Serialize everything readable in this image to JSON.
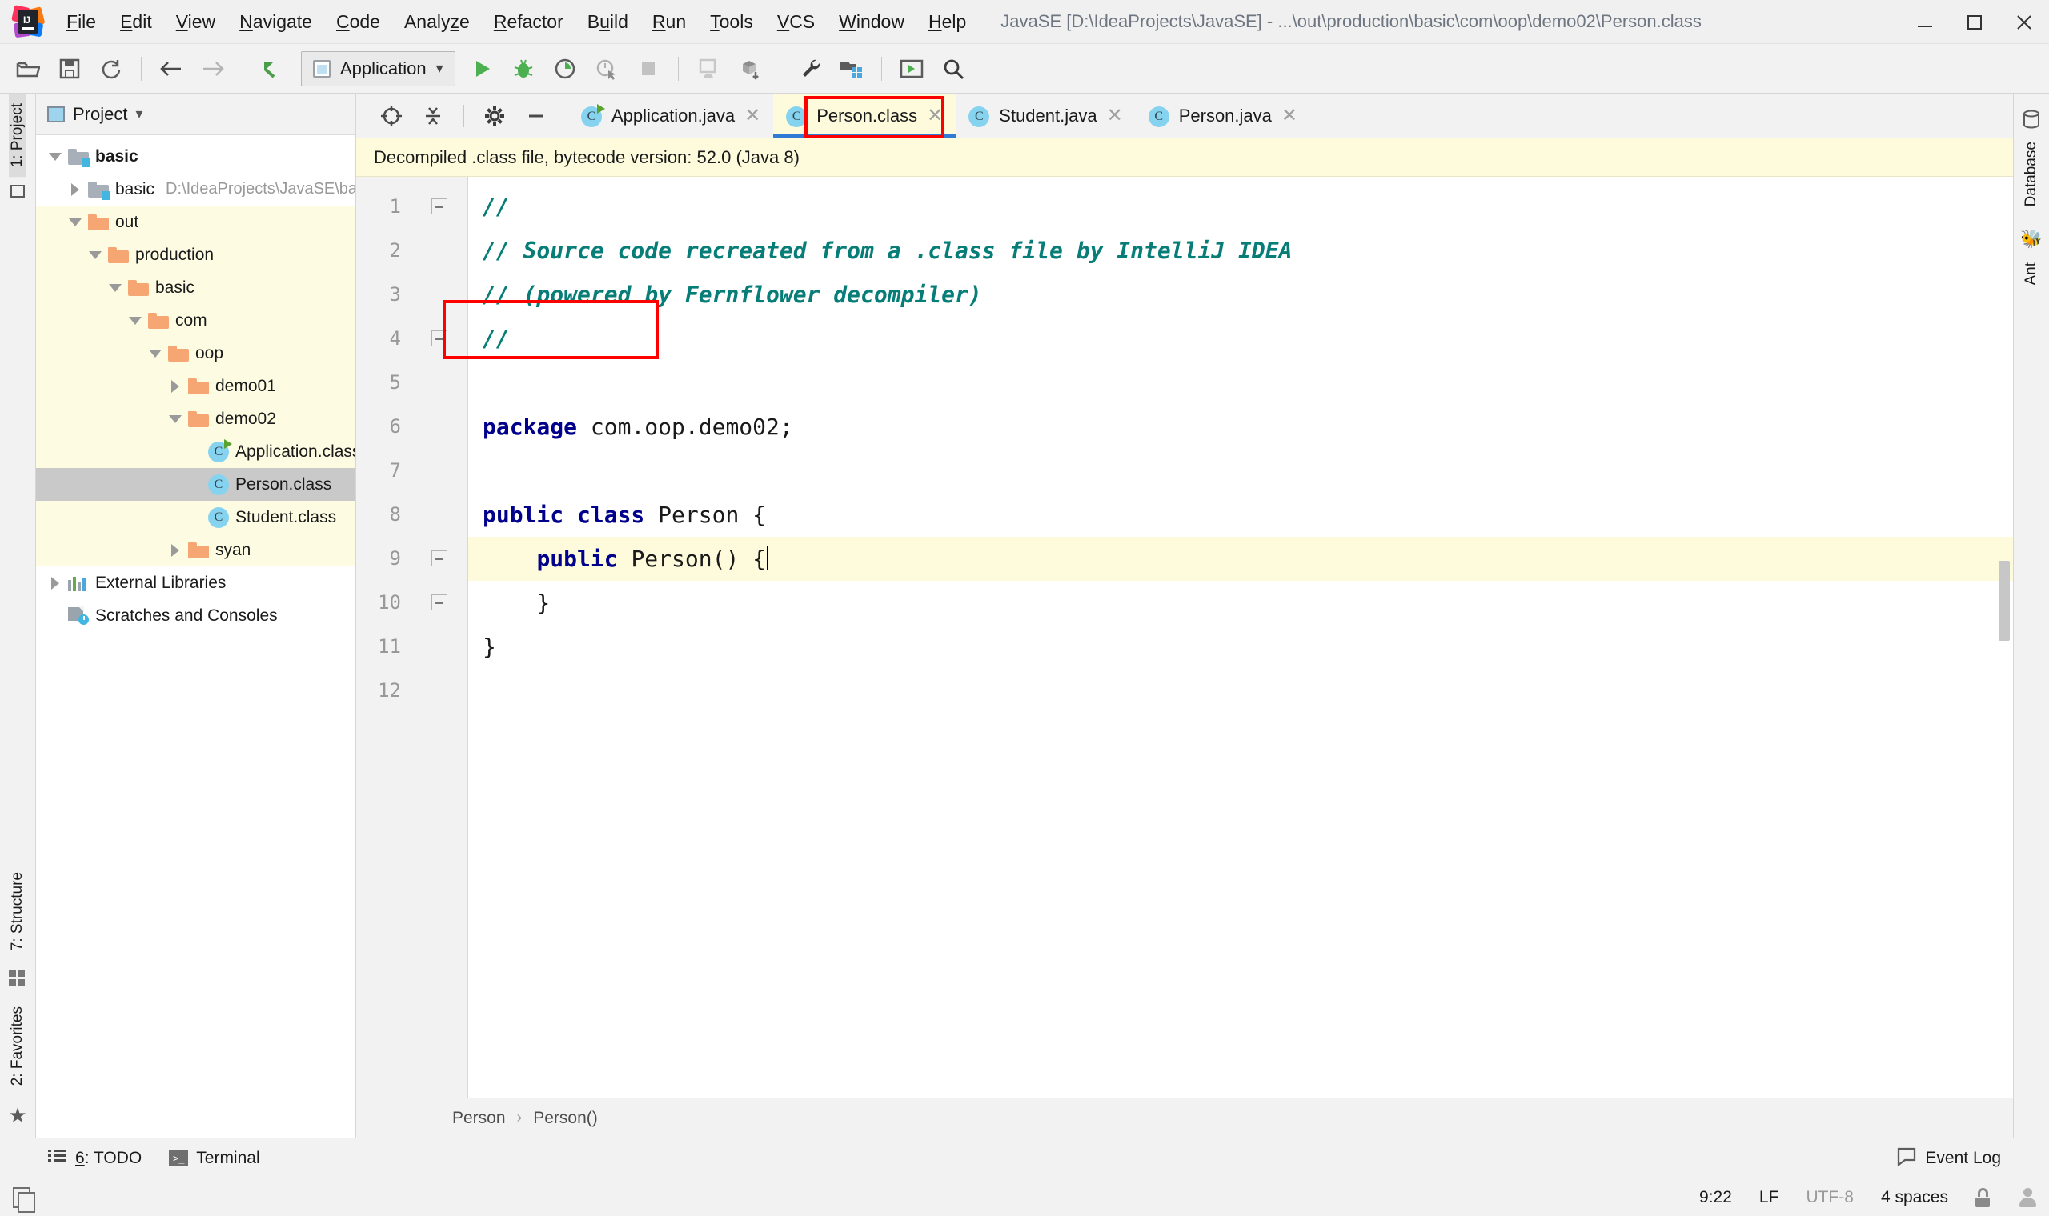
{
  "window": {
    "title": "JavaSE [D:\\IdeaProjects\\JavaSE] - ...\\out\\production\\basic\\com\\oop\\demo02\\Person.class",
    "logo_name": "intellij-idea-logo",
    "minimize": "—",
    "maximize": "□",
    "close": "✕"
  },
  "menubar": {
    "items": [
      {
        "pre": "",
        "mn": "F",
        "post": "ile"
      },
      {
        "pre": "",
        "mn": "E",
        "post": "dit"
      },
      {
        "pre": "",
        "mn": "V",
        "post": "iew"
      },
      {
        "pre": "",
        "mn": "N",
        "post": "avigate"
      },
      {
        "pre": "",
        "mn": "C",
        "post": "ode"
      },
      {
        "pre": "Analy",
        "mn": "z",
        "post": "e"
      },
      {
        "pre": "",
        "mn": "R",
        "post": "efactor"
      },
      {
        "pre": "B",
        "mn": "u",
        "post": "ild"
      },
      {
        "pre": "",
        "mn": "R",
        "post": "un"
      },
      {
        "pre": "",
        "mn": "T",
        "post": "ools"
      },
      {
        "pre": "",
        "mn": "V",
        "post": "CS"
      },
      {
        "pre": "",
        "mn": "W",
        "post": "indow"
      },
      {
        "pre": "",
        "mn": "H",
        "post": "elp"
      }
    ]
  },
  "toolbar": {
    "run_config_label": "Application",
    "dropdown_caret": "∨",
    "icons": [
      "open-folder-icon",
      "save-all-icon",
      "sync-icon",
      "back-arrow-icon",
      "forward-arrow-icon",
      "revert-icon"
    ],
    "right_icons": [
      "run-with-coverage-icon",
      "stop-icon",
      "android-device-icon",
      "sync-gradle-icon",
      "settings-wrench-icon",
      "project-structure-icon",
      "avd-manager-icon",
      "search-everywhere-icon"
    ]
  },
  "left_strip": {
    "project_tab": "1: Project",
    "structure_tab": "7: Structure",
    "favorites_tab": "2: Favorites"
  },
  "right_strip": {
    "database_tab": "Database",
    "ant_tab": "Ant"
  },
  "project_panel": {
    "title": "Project",
    "dropdown_caret": "▾",
    "tree": [
      {
        "label": "basic",
        "indent": 0,
        "arrow": "down",
        "icon": "module-folder",
        "bold": true,
        "excluded": false,
        "selected": false,
        "path": ""
      },
      {
        "label": "basic",
        "indent": 1,
        "arrow": "right",
        "icon": "module-folder",
        "bold": false,
        "excluded": false,
        "selected": false,
        "path": "D:\\IdeaProjects\\JavaSE\\basic"
      },
      {
        "label": "out",
        "indent": 1,
        "arrow": "down",
        "icon": "folder",
        "bold": false,
        "excluded": true,
        "selected": false,
        "path": ""
      },
      {
        "label": "production",
        "indent": 2,
        "arrow": "down",
        "icon": "folder",
        "bold": false,
        "excluded": true,
        "selected": false,
        "path": ""
      },
      {
        "label": "basic",
        "indent": 3,
        "arrow": "down",
        "icon": "folder",
        "bold": false,
        "excluded": true,
        "selected": false,
        "path": ""
      },
      {
        "label": "com",
        "indent": 4,
        "arrow": "down",
        "icon": "folder",
        "bold": false,
        "excluded": true,
        "selected": false,
        "path": ""
      },
      {
        "label": "oop",
        "indent": 5,
        "arrow": "down",
        "icon": "folder",
        "bold": false,
        "excluded": true,
        "selected": false,
        "path": ""
      },
      {
        "label": "demo01",
        "indent": 6,
        "arrow": "right",
        "icon": "folder",
        "bold": false,
        "excluded": true,
        "selected": false,
        "path": ""
      },
      {
        "label": "demo02",
        "indent": 6,
        "arrow": "down",
        "icon": "folder",
        "bold": false,
        "excluded": true,
        "selected": false,
        "path": ""
      },
      {
        "label": "Application.class",
        "indent": 7,
        "arrow": "none",
        "icon": "class-runnable",
        "bold": false,
        "excluded": true,
        "selected": false,
        "path": ""
      },
      {
        "label": "Person.class",
        "indent": 7,
        "arrow": "none",
        "icon": "class",
        "bold": false,
        "excluded": true,
        "selected": true,
        "path": ""
      },
      {
        "label": "Student.class",
        "indent": 7,
        "arrow": "none",
        "icon": "class",
        "bold": false,
        "excluded": true,
        "selected": false,
        "path": ""
      },
      {
        "label": "syan",
        "indent": 6,
        "arrow": "right",
        "icon": "folder",
        "bold": false,
        "excluded": true,
        "selected": false,
        "path": ""
      },
      {
        "label": "External Libraries",
        "indent": 0,
        "arrow": "right",
        "icon": "libraries",
        "bold": false,
        "excluded": false,
        "selected": false,
        "path": ""
      },
      {
        "label": "Scratches and Consoles",
        "indent": 0,
        "arrow": "none",
        "icon": "scratches",
        "bold": false,
        "excluded": false,
        "selected": false,
        "path": ""
      }
    ]
  },
  "editor": {
    "tabs": [
      {
        "label": "Application.java",
        "icon": "class-runnable",
        "active": false,
        "close": "✕"
      },
      {
        "label": "Person.class",
        "icon": "class",
        "active": true,
        "close": "✕"
      },
      {
        "label": "Student.java",
        "icon": "class",
        "active": false,
        "close": "✕"
      },
      {
        "label": "Person.java",
        "icon": "class",
        "active": false,
        "close": "✕"
      }
    ],
    "notice": "Decompiled .class file, bytecode version: 52.0 (Java 8)",
    "line_numbers": [
      "1",
      "2",
      "3",
      "4",
      "5",
      "6",
      "7",
      "8",
      "9",
      "10",
      "11",
      "12"
    ],
    "code_lines": [
      {
        "n": 1,
        "tokens": [
          {
            "t": "//",
            "c": "cmt"
          }
        ],
        "highlight": false,
        "fold": "start"
      },
      {
        "n": 2,
        "tokens": [
          {
            "t": "// Source code recreated from a .class file by IntelliJ IDEA",
            "c": "cmt"
          }
        ],
        "highlight": false,
        "fold": "none"
      },
      {
        "n": 3,
        "tokens": [
          {
            "t": "// (powered by Fernflower decompiler)",
            "c": "cmt"
          }
        ],
        "highlight": false,
        "fold": "none"
      },
      {
        "n": 4,
        "tokens": [
          {
            "t": "//",
            "c": "cmt"
          }
        ],
        "highlight": false,
        "fold": "end"
      },
      {
        "n": 5,
        "tokens": [],
        "highlight": false,
        "fold": "none"
      },
      {
        "n": 6,
        "tokens": [
          {
            "t": "package",
            "c": "kw"
          },
          {
            "t": " com.oop.demo02;",
            "c": "plain"
          }
        ],
        "highlight": false,
        "fold": "none"
      },
      {
        "n": 7,
        "tokens": [],
        "highlight": false,
        "fold": "none"
      },
      {
        "n": 8,
        "tokens": [
          {
            "t": "public class",
            "c": "kw"
          },
          {
            "t": " Person {",
            "c": "plain"
          }
        ],
        "highlight": false,
        "fold": "none"
      },
      {
        "n": 9,
        "tokens": [
          {
            "t": "    ",
            "c": "plain"
          },
          {
            "t": "public",
            "c": "kw"
          },
          {
            "t": " Person() {",
            "c": "plain"
          }
        ],
        "highlight": true,
        "fold": "start",
        "caret": true
      },
      {
        "n": 10,
        "tokens": [
          {
            "t": "    }",
            "c": "plain"
          }
        ],
        "highlight": false,
        "fold": "end"
      },
      {
        "n": 11,
        "tokens": [
          {
            "t": "}",
            "c": "plain"
          }
        ],
        "highlight": false,
        "fold": "none"
      },
      {
        "n": 12,
        "tokens": [],
        "highlight": false,
        "fold": "none"
      }
    ],
    "breadcrumbs": [
      "Person",
      "Person()"
    ],
    "breadcrumb_sep": "›"
  },
  "bottom_toolwindows": {
    "todo": {
      "pre": "",
      "mn": "6",
      "post": ": TODO",
      "icon": "todo-list-icon"
    },
    "terminal": {
      "label": "Terminal",
      "icon": "terminal-icon"
    },
    "event_log": {
      "label": "Event Log",
      "icon": "event-log-icon"
    }
  },
  "statusbar": {
    "caret_position": "9:22",
    "line_separator": "LF",
    "encoding": "UTF-8",
    "indent": "4 spaces",
    "lock_icon": "lock-icon",
    "person_icon": "person-icon",
    "doc_icon": "document-icon"
  },
  "colors": {
    "accent_blue": "#2f7bd5",
    "excluded_yellow": "#fdfce3",
    "keyword_navy": "#00008c",
    "comment_teal": "#077d77",
    "annotation_red": "#ff0000",
    "folder_orange": "#f5a673",
    "class_cyan": "#86d3ef"
  }
}
